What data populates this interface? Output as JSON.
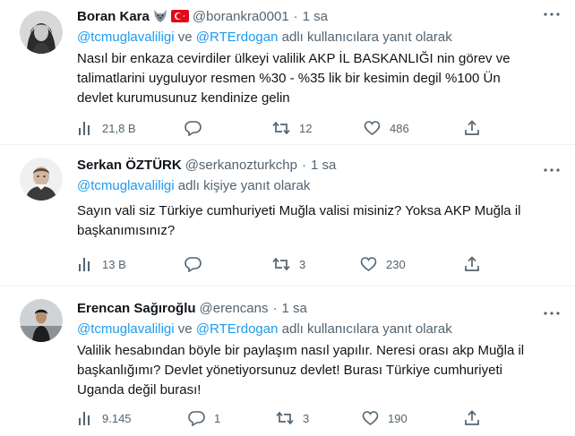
{
  "tweets": [
    {
      "name": "Boran Kara",
      "handle": "@borankra0001",
      "time": "1 sa",
      "reply_prefix": "",
      "mention1": "@tcmuglavaliligi",
      "reply_mid": " ve ",
      "mention2": "@RTErdogan",
      "reply_suffix": " adlı kullanıcılara yanıt olarak",
      "text_lines": [
        "Nasıl bir enkaza cevirdiler ülkeyi valilik AKP İL BASKANLIĞI nin görev ve",
        "talimatlarini uyguluyor resmen %30 - %35 lik bir kesimin degil %100 Ün",
        "devlet kurumusunuz kendinize gelin"
      ],
      "views": "21,8 B",
      "replies": "",
      "retweets": "12",
      "likes": "486"
    },
    {
      "name": "Serkan ÖZTÜRK",
      "handle": "@serkanozturkchp",
      "time": "1 sa",
      "mention1": "@tcmuglavaliligi",
      "reply_suffix": " adlı kişiye yanıt olarak",
      "text_lines": [
        "Sayın vali siz Türkiye cumhuriyeti Muğla valisi misiniz? Yoksa AKP Muğla il",
        "başkanımısınız?"
      ],
      "views": "13 B",
      "replies": "",
      "retweets": "3",
      "likes": "230"
    },
    {
      "name": "Erencan Sağıroğlu",
      "handle": "@erencans",
      "time": "1 sa",
      "mention1": "@tcmuglavaliligi",
      "reply_mid": " ve ",
      "mention2": "@RTErdogan",
      "reply_suffix": " adlı kullanıcılara yanıt olarak",
      "text_lines": [
        "Valilik hesabından böyle bir paylaşım nasıl yapılır. Neresi orası akp Muğla il",
        "başkanlığımı? Devlet yönetiyorsunuz devlet! Burası Türkiye cumhuriyeti",
        "Uganda değil burası!"
      ],
      "views": "9.145",
      "replies": "1",
      "retweets": "3",
      "likes": "190"
    }
  ],
  "icons": {
    "views": "analytics-icon",
    "reply": "reply-icon",
    "retweet": "retweet-icon",
    "like": "heart-icon",
    "share": "share-icon",
    "more": "more-icon",
    "wolf": "wolf-emoji-icon",
    "flag": "turkey-flag-icon"
  },
  "colors": {
    "text": "#0f1419",
    "secondary": "#536471",
    "link": "#1d9bf0",
    "divider": "#eff3f4",
    "flag_red": "#e30a17"
  }
}
